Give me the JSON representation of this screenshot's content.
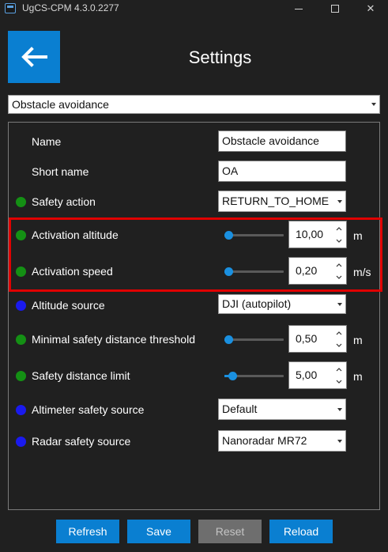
{
  "window": {
    "title": "UgCS-CPM 4.3.0.2277",
    "min_glyph": "",
    "max_glyph": "",
    "close_glyph": "✕"
  },
  "header": {
    "title": "Settings",
    "back_icon": "arrow-left-icon"
  },
  "profile_select": {
    "value": "Obstacle avoidance"
  },
  "fields": {
    "name": {
      "label": "Name",
      "value": "Obstacle avoidance"
    },
    "short_name": {
      "label": "Short name",
      "value": "OA"
    },
    "safety_action": {
      "label": "Safety action",
      "value": "RETURN_TO_HOME",
      "status": "green"
    },
    "activation_altitude": {
      "label": "Activation altitude",
      "value": "10,00",
      "unit": "m",
      "status": "green",
      "slider_level": 0.0
    },
    "activation_speed": {
      "label": "Activation speed",
      "value": "0,20",
      "unit": "m/s",
      "status": "green",
      "slider_level": 0.0
    },
    "altitude_source": {
      "label": "Altitude source",
      "value": "DJI (autopilot)",
      "status": "blue"
    },
    "min_safety_distance": {
      "label": "Minimal safety distance threshold",
      "value": "0,50",
      "unit": "m",
      "status": "green",
      "slider_level": 0.0
    },
    "safety_distance_limit": {
      "label": "Safety distance limit",
      "value": "5,00",
      "unit": "m",
      "status": "green",
      "slider_level": 0.08
    },
    "altimeter_safety_source": {
      "label": "Altimeter safety source",
      "value": "Default",
      "status": "blue"
    },
    "radar_safety_source": {
      "label": "Radar safety source",
      "value": "Nanoradar MR72",
      "status": "blue"
    }
  },
  "buttons": {
    "refresh": "Refresh",
    "save": "Save",
    "reset": "Reset",
    "reload": "Reload"
  },
  "colors": {
    "accent": "#0a7fd1",
    "background": "#202020",
    "status_green": "#149014",
    "status_blue": "#1a1aee",
    "highlight": "#e00000"
  }
}
